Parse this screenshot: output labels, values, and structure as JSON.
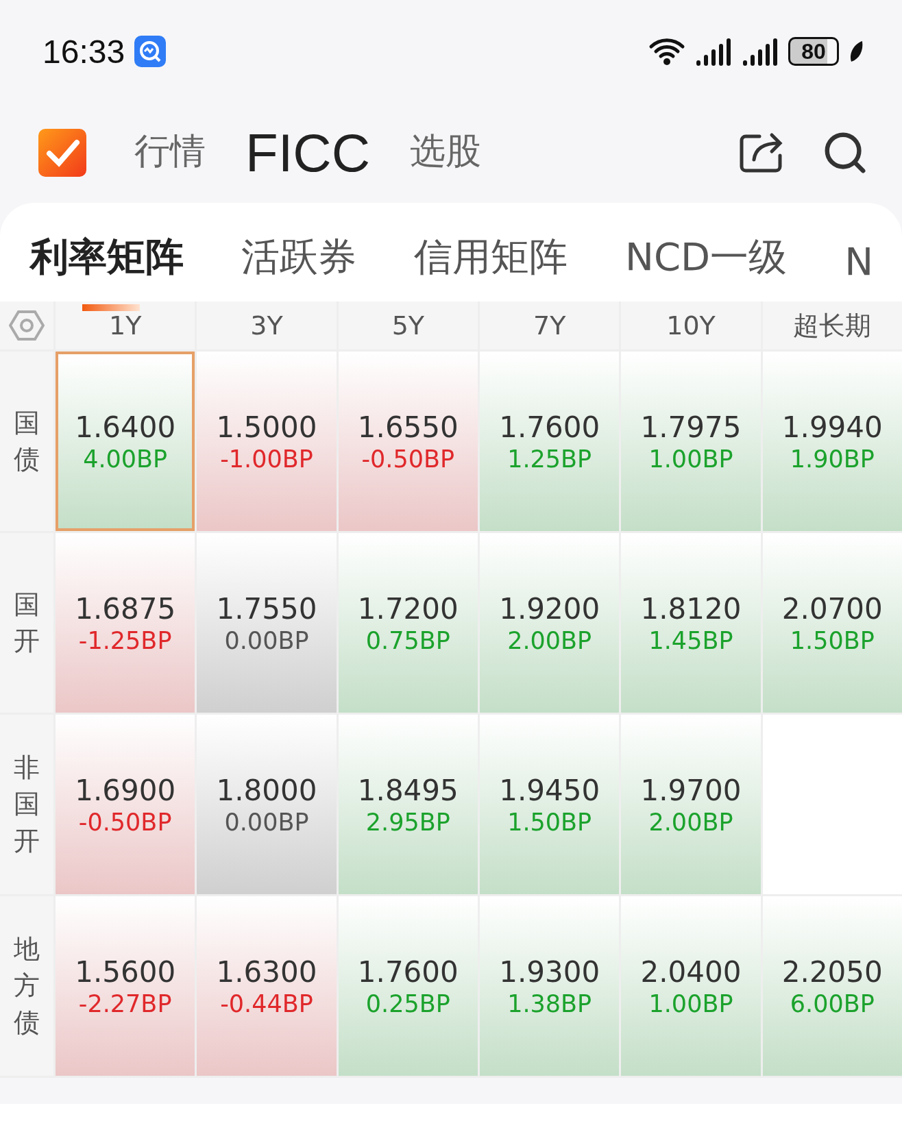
{
  "status_bar": {
    "time": "16:33",
    "battery": "80"
  },
  "header": {
    "tabs": [
      {
        "label": "行情",
        "selected": false
      },
      {
        "label": "FICC",
        "selected": true
      },
      {
        "label": "选股",
        "selected": false
      }
    ]
  },
  "sub_tabs": [
    {
      "label": "利率矩阵",
      "selected": true
    },
    {
      "label": "活跃券",
      "selected": false
    },
    {
      "label": "信用矩阵",
      "selected": false
    },
    {
      "label": "NCD一级",
      "selected": false
    },
    {
      "label": "N",
      "selected": false
    }
  ],
  "matrix": {
    "columns": [
      "1Y",
      "3Y",
      "5Y",
      "7Y",
      "10Y",
      "超长期"
    ],
    "rows": [
      {
        "label": "国债",
        "cells": [
          {
            "kind": "quote",
            "value": "1.6400",
            "change": "4.00BP",
            "color": "#1ba22c",
            "selected": true
          },
          {
            "kind": "quote",
            "value": "1.5000",
            "change": "-1.00BP",
            "color": "#e0282b",
            "selected": false
          },
          {
            "kind": "quote",
            "value": "1.6550",
            "change": "-0.50BP",
            "color": "#e0282b",
            "selected": false
          },
          {
            "kind": "quote",
            "value": "1.7600",
            "change": "1.25BP",
            "color": "#1ba22c",
            "selected": false
          },
          {
            "kind": "quote",
            "value": "1.7975",
            "change": "1.00BP",
            "color": "#1ba22c",
            "selected": false
          },
          {
            "kind": "quote",
            "value": "1.9940",
            "change": "1.90BP",
            "color": "#1ba22c",
            "selected": false
          }
        ]
      },
      {
        "label": "国开",
        "cells": [
          {
            "kind": "quote",
            "value": "1.6875",
            "change": "-1.25BP",
            "color": "#e0282b",
            "selected": false
          },
          {
            "kind": "quote",
            "value": "1.7550",
            "change": "0.00BP",
            "color": "#555555",
            "selected": false
          },
          {
            "kind": "quote",
            "value": "1.7200",
            "change": "0.75BP",
            "color": "#1ba22c",
            "selected": false
          },
          {
            "kind": "quote",
            "value": "1.9200",
            "change": "2.00BP",
            "color": "#1ba22c",
            "selected": false
          },
          {
            "kind": "quote",
            "value": "1.8120",
            "change": "1.45BP",
            "color": "#1ba22c",
            "selected": false
          },
          {
            "kind": "quote",
            "value": "2.0700",
            "change": "1.50BP",
            "color": "#1ba22c",
            "selected": false
          }
        ]
      },
      {
        "label": "非国开",
        "cells": [
          {
            "kind": "quote",
            "value": "1.6900",
            "change": "-0.50BP",
            "color": "#e0282b",
            "selected": false
          },
          {
            "kind": "quote",
            "value": "1.8000",
            "change": "0.00BP",
            "color": "#555555",
            "selected": false
          },
          {
            "kind": "quote",
            "value": "1.8495",
            "change": "2.95BP",
            "color": "#1ba22c",
            "selected": false
          },
          {
            "kind": "quote",
            "value": "1.9450",
            "change": "1.50BP",
            "color": "#1ba22c",
            "selected": false
          },
          {
            "kind": "quote",
            "value": "1.9700",
            "change": "2.00BP",
            "color": "#1ba22c",
            "selected": false
          },
          {
            "kind": "empty"
          }
        ]
      },
      {
        "label": "地方债",
        "cells": [
          {
            "kind": "quote",
            "value": "1.5600",
            "change": "-2.27BP",
            "color": "#e0282b",
            "selected": false
          },
          {
            "kind": "quote",
            "value": "1.6300",
            "change": "-0.44BP",
            "color": "#e0282b",
            "selected": false
          },
          {
            "kind": "quote",
            "value": "1.7600",
            "change": "0.25BP",
            "color": "#1ba22c",
            "selected": false
          },
          {
            "kind": "quote",
            "value": "1.9300",
            "change": "1.38BP",
            "color": "#1ba22c",
            "selected": false
          },
          {
            "kind": "quote",
            "value": "2.0400",
            "change": "1.00BP",
            "color": "#1ba22c",
            "selected": false
          },
          {
            "kind": "quote",
            "value": "2.2050",
            "change": "6.00BP",
            "color": "#1ba22c",
            "selected": false
          }
        ]
      }
    ]
  }
}
